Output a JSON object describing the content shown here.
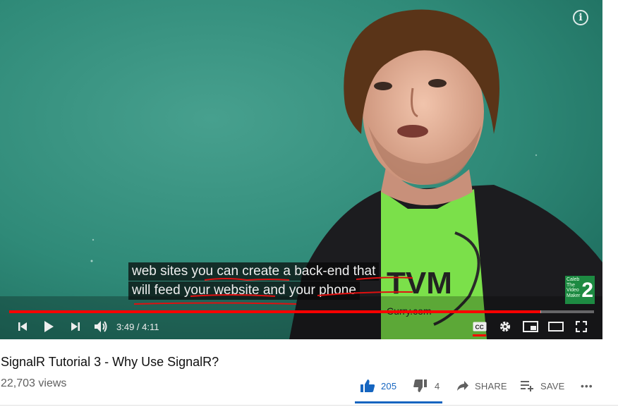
{
  "player": {
    "captions": [
      "web sites you can create a back-end that",
      "will feed your website and your phone"
    ],
    "shirt_text": "TVM",
    "shirt_subtext": "Curry.com",
    "watermark": {
      "text": "Caleb The Video Maker",
      "number": "2"
    },
    "info_icon": "i",
    "time_display": "3:49 / 4:11",
    "progress": {
      "played_fraction": 0.908,
      "loaded_fraction": 0.91
    },
    "icons": {
      "previous": "skip-previous-icon",
      "play": "play-icon",
      "next": "skip-next-icon",
      "volume": "volume-icon",
      "cc": "closed-captions-icon",
      "settings": "gear-icon",
      "miniplayer": "miniplayer-icon",
      "theater": "theater-mode-icon",
      "fullscreen": "fullscreen-icon"
    },
    "colors": {
      "progress_played": "#ff0000",
      "chalkboard": "#2f8a78",
      "shirt": "#7be04a"
    }
  },
  "video": {
    "title": "SignalR Tutorial 3 - Why Use SignalR?",
    "views": "22,703 views"
  },
  "actions": {
    "likes": "205",
    "dislikes": "4",
    "share_label": "SHARE",
    "save_label": "SAVE",
    "more_label": "•••",
    "like_color": "#1565c0"
  }
}
